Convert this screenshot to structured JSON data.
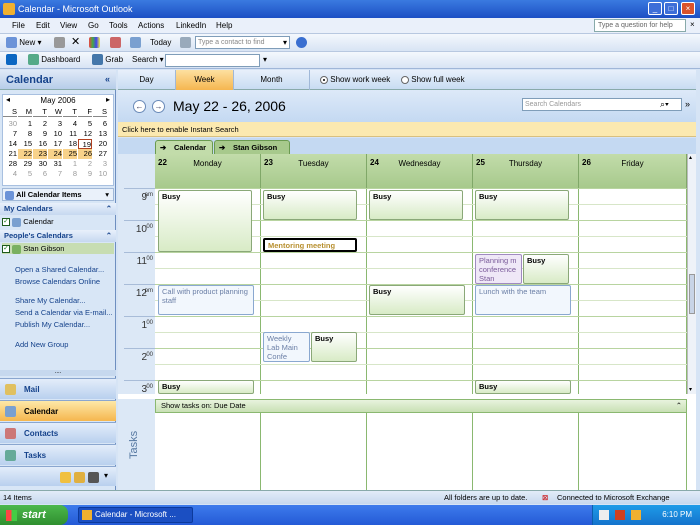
{
  "window": {
    "title": "Calendar - Microsoft Outlook"
  },
  "menu": {
    "items": [
      "File",
      "Edit",
      "View",
      "Go",
      "Tools",
      "Actions",
      "LinkedIn",
      "Help"
    ],
    "help_placeholder": "Type a question for help"
  },
  "toolbar1": {
    "new_label": "New",
    "today_label": "Today",
    "contact_placeholder": "Type a contact to find"
  },
  "toolbar2": {
    "dashboard_label": "Dashboard",
    "grab_label": "Grab",
    "search_label": "Search"
  },
  "nav": {
    "title": "Calendar",
    "mini_cal": {
      "title": "May 2006",
      "weekdays": [
        "S",
        "M",
        "T",
        "W",
        "T",
        "F",
        "S"
      ],
      "weeks": [
        [
          "30",
          "1",
          "2",
          "3",
          "4",
          "5",
          "6"
        ],
        [
          "7",
          "8",
          "9",
          "10",
          "11",
          "12",
          "13"
        ],
        [
          "14",
          "15",
          "16",
          "17",
          "18",
          "19",
          "20"
        ],
        [
          "21",
          "22",
          "23",
          "24",
          "25",
          "26",
          "27"
        ],
        [
          "28",
          "29",
          "30",
          "31",
          "1",
          "2",
          "3"
        ],
        [
          "4",
          "5",
          "6",
          "7",
          "8",
          "9",
          "10"
        ]
      ]
    },
    "all_items_label": "All Calendar Items",
    "my_calendars_label": "My Calendars",
    "my_calendar_item": "Calendar",
    "peoples_calendars_label": "People's Calendars",
    "people_item": "Stan Gibson",
    "links": [
      "Open a Shared Calendar...",
      "Browse Calendars Online",
      "Share My Calendar...",
      "Send a Calendar via E-mail...",
      "Publish My Calendar...",
      "Add New Group"
    ],
    "buttons": {
      "mail": "Mail",
      "calendar": "Calendar",
      "contacts": "Contacts",
      "tasks": "Tasks"
    }
  },
  "view": {
    "tabs": [
      "Day",
      "Week",
      "Month"
    ],
    "show_work_week": "Show work week",
    "show_full_week": "Show full week",
    "date_range": "May 22 - 26, 2006",
    "search_placeholder": "Search Calendars",
    "instant_search": "Click here to enable Instant Search",
    "calendar_tabs": [
      "Calendar",
      "Stan Gibson"
    ]
  },
  "hours": [
    {
      "h": "9",
      "m": "am"
    },
    {
      "h": "10",
      "m": "00"
    },
    {
      "h": "11",
      "m": "00"
    },
    {
      "h": "12",
      "m": "pm"
    },
    {
      "h": "1",
      "m": "00"
    },
    {
      "h": "2",
      "m": "00"
    },
    {
      "h": "3",
      "m": "00"
    }
  ],
  "days": [
    {
      "num": "22",
      "name": "Monday"
    },
    {
      "num": "23",
      "name": "Tuesday"
    },
    {
      "num": "24",
      "name": "Wednesday"
    },
    {
      "num": "25",
      "name": "Thursday"
    },
    {
      "num": "26",
      "name": "Friday"
    }
  ],
  "appointments": {
    "busy": "Busy",
    "mentoring": "Mentoring meeting with",
    "call_product": "Call with product planning staff",
    "weekly_lab": "Weekly Lab Main Confe Debra Dons",
    "lunch": "Lunch with the team",
    "planning": "Planning m conference Stan Gibsor"
  },
  "tasks": {
    "label": "Tasks",
    "bar_text": "Show tasks on: Due Date"
  },
  "status": {
    "items_count": "14 Items",
    "folders": "All folders are up to date.",
    "connection": "Connected to Microsoft Exchange"
  },
  "taskbar": {
    "start_label": "start",
    "task_item": "Calendar - Microsoft ...",
    "clock": "6:10 PM"
  }
}
